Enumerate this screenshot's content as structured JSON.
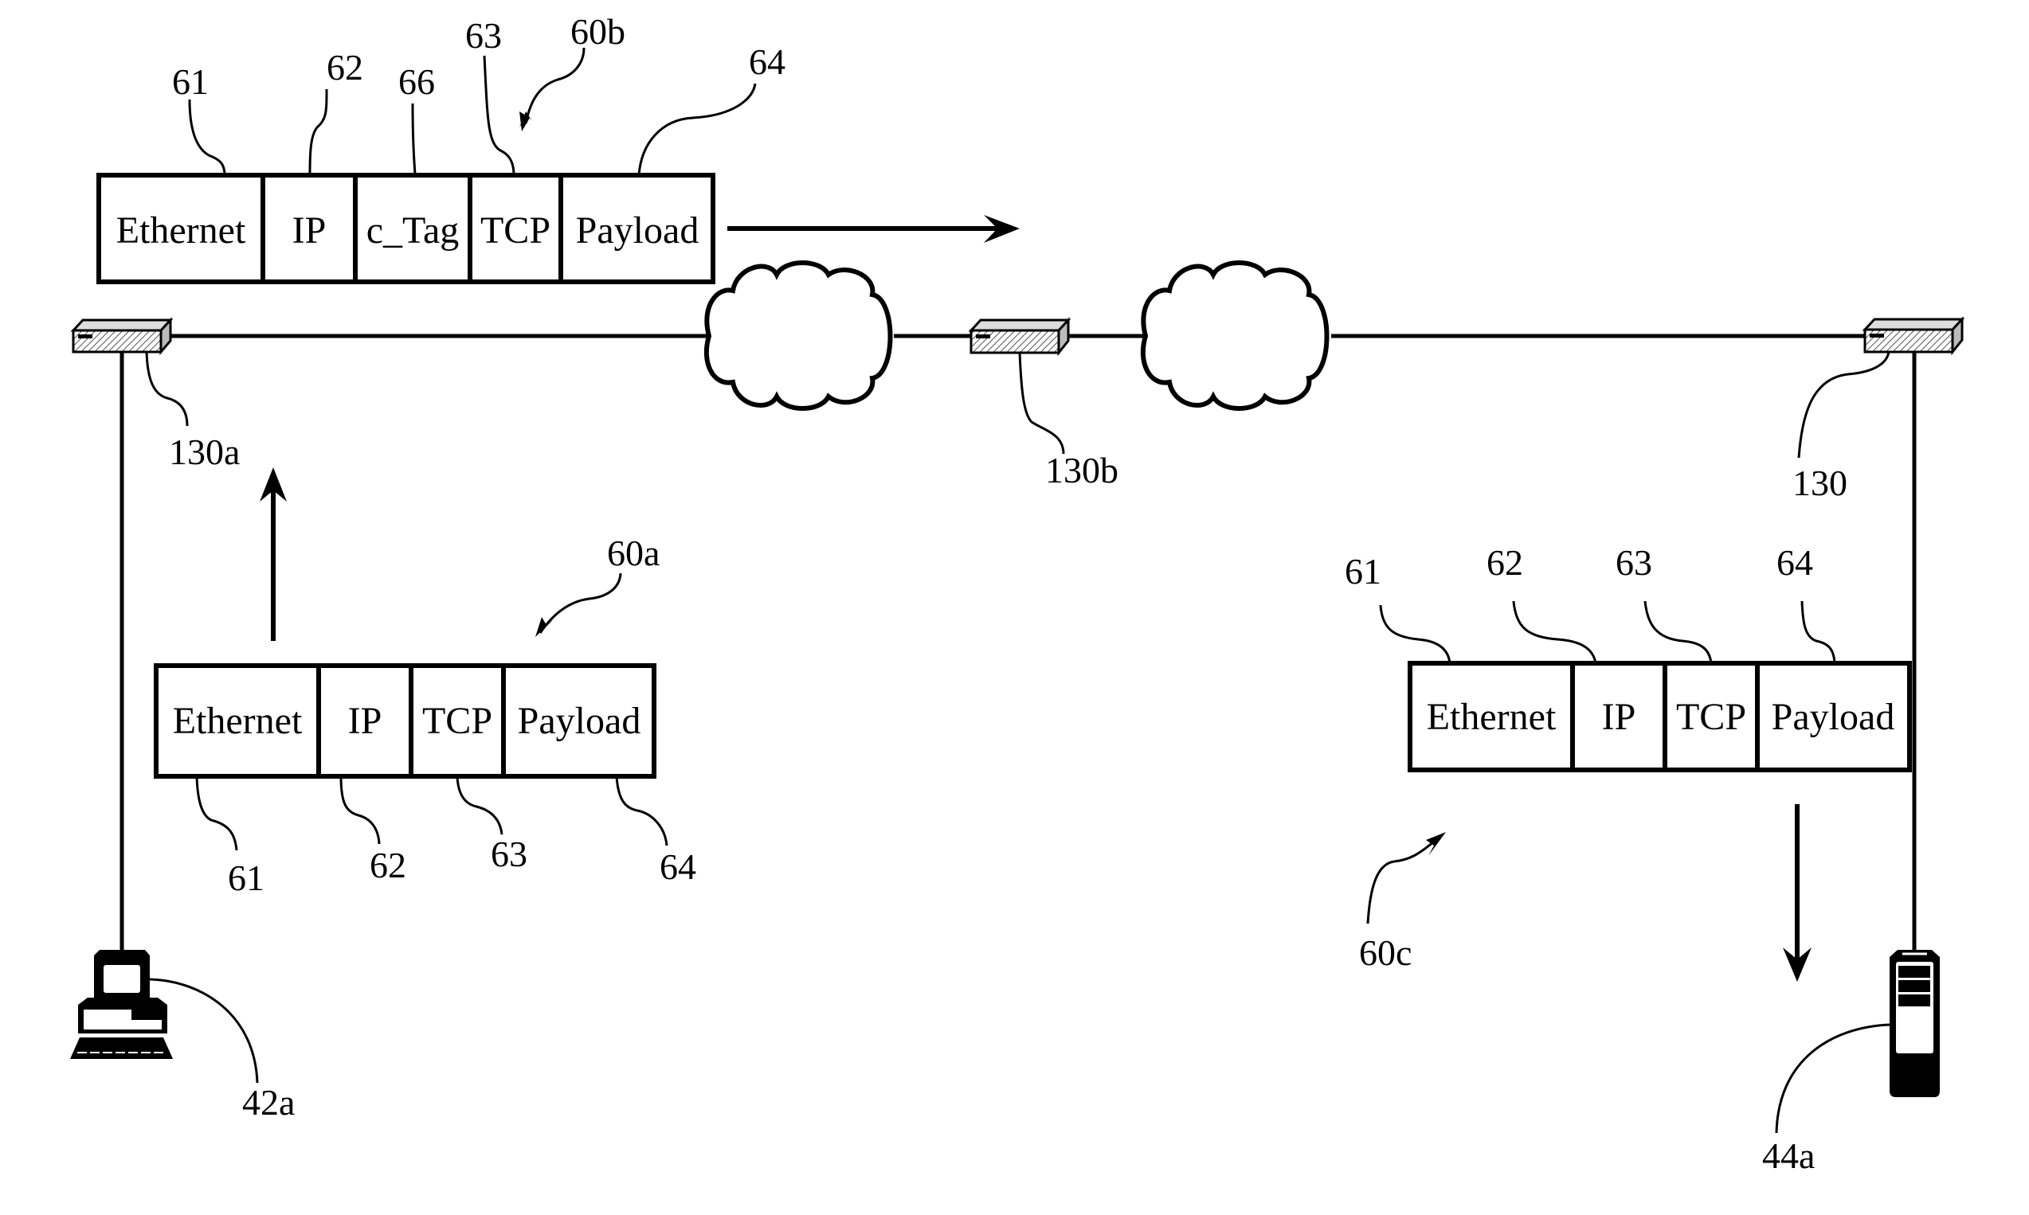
{
  "figure": {
    "packets": [
      {
        "id": "60b",
        "ref": "60b",
        "fields": [
          {
            "label": "Ethernet",
            "ref": "61"
          },
          {
            "label": "IP",
            "ref": "62"
          },
          {
            "label": "c_Tag",
            "ref": "66"
          },
          {
            "label": "TCP",
            "ref": "63"
          },
          {
            "label": "Payload",
            "ref": "64"
          }
        ],
        "direction": "right"
      },
      {
        "id": "60a",
        "ref": "60a",
        "fields": [
          {
            "label": "Ethernet",
            "ref": "61"
          },
          {
            "label": "IP",
            "ref": "62"
          },
          {
            "label": "TCP",
            "ref": "63"
          },
          {
            "label": "Payload",
            "ref": "64"
          }
        ],
        "direction": "up"
      },
      {
        "id": "60c",
        "ref": "60c",
        "fields": [
          {
            "label": "Ethernet",
            "ref": "61"
          },
          {
            "label": "IP",
            "ref": "62"
          },
          {
            "label": "TCP",
            "ref": "63"
          },
          {
            "label": "Payload",
            "ref": "64"
          }
        ],
        "direction": "down"
      }
    ],
    "nodes": {
      "switch_a": "130a",
      "switch_b": "130b",
      "switch_c": "130",
      "client": "42a",
      "server": "44a"
    },
    "clouds": [
      "network-cloud-1",
      "network-cloud-2"
    ]
  }
}
